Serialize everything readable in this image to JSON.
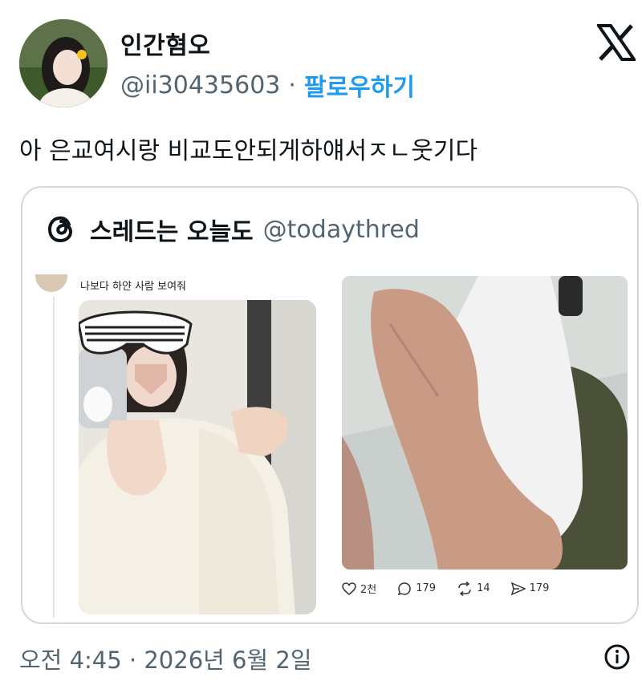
{
  "author": {
    "display_name": "인간혐오",
    "handle": "@ii30435603",
    "separator": "·",
    "follow_label": "팔로우하기"
  },
  "tweet": {
    "text": "아 은교여시랑 비교도안되게하얘서ㅈㄴ웃기다"
  },
  "quote": {
    "author_name": "스레드는 오늘도",
    "author_handle": "@todaythred",
    "caption": "나보다 하얀 사람 보여줘",
    "stats": {
      "likes": "2천",
      "replies": "179",
      "reposts": "14",
      "shares": "179"
    }
  },
  "footer": {
    "timestamp": "오전 4:45 · 2026년 6월 2일"
  },
  "colors": {
    "accent": "#1d9bf0",
    "secondary_text": "#536471",
    "border": "#cfd9de"
  },
  "icons": [
    "x-logo-icon",
    "threads-logo-icon",
    "heart-icon",
    "reply-icon",
    "repost-icon",
    "share-icon",
    "info-icon"
  ]
}
